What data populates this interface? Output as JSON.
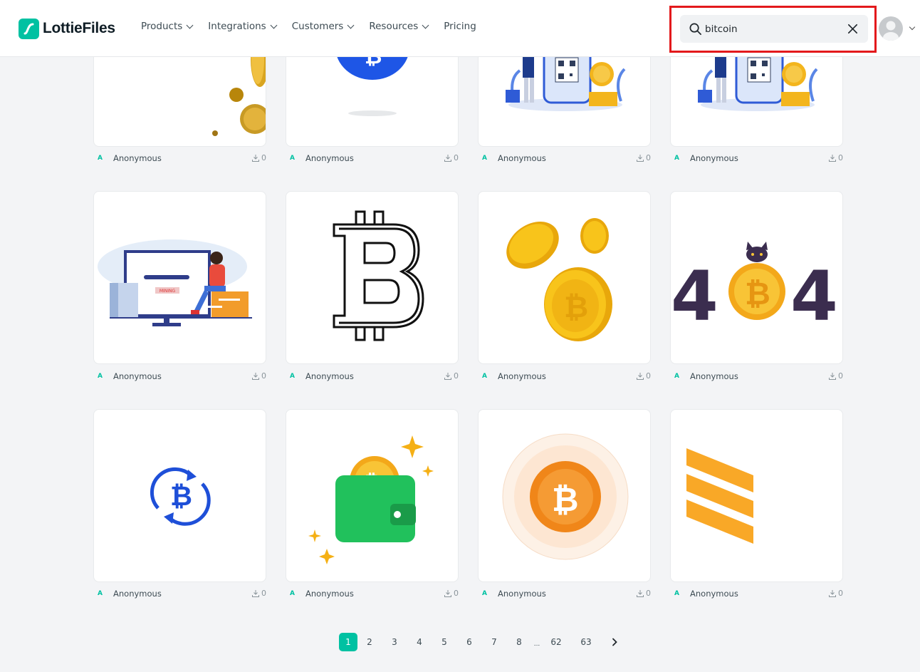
{
  "brand": {
    "name": "LottieFiles",
    "accent": "#00c1a2"
  },
  "nav": [
    {
      "label": "Products",
      "has_dropdown": true
    },
    {
      "label": "Integrations",
      "has_dropdown": true
    },
    {
      "label": "Customers",
      "has_dropdown": true
    },
    {
      "label": "Resources",
      "has_dropdown": true
    },
    {
      "label": "Pricing",
      "has_dropdown": false
    }
  ],
  "search": {
    "value": "bitcoin",
    "icon": "search-icon",
    "clear_icon": "close-icon",
    "highlight_color": "#e3191c"
  },
  "cards": [
    {
      "illustration": "bitcoin-coins-falling",
      "author": "Anonymous",
      "downloads": "0"
    },
    {
      "illustration": "bitcoin-blue-coin",
      "author": "Anonymous",
      "downloads": "0"
    },
    {
      "illustration": "person-phone-qr-coins",
      "author": "Anonymous",
      "downloads": "0"
    },
    {
      "illustration": "person-phone-qr-coins",
      "author": "Anonymous",
      "downloads": "0"
    },
    {
      "illustration": "bitcoin-mining-person",
      "author": "Anonymous",
      "downloads": "0",
      "inner_text": "MINING"
    },
    {
      "illustration": "bitcoin-outline-symbol",
      "author": "Anonymous",
      "downloads": "0"
    },
    {
      "illustration": "bitcoin-gold-coins",
      "author": "Anonymous",
      "downloads": "0"
    },
    {
      "illustration": "bitcoin-404-cat",
      "author": "Anonymous",
      "downloads": "0",
      "inner_text": "4"
    },
    {
      "illustration": "bitcoin-exchange-icon",
      "author": "Anonymous",
      "downloads": "0"
    },
    {
      "illustration": "bitcoin-green-wallet",
      "author": "Anonymous",
      "downloads": "0"
    },
    {
      "illustration": "bitcoin-orange-coin",
      "author": "Anonymous",
      "downloads": "0"
    },
    {
      "illustration": "orange-stripes-logo",
      "author": "Anonymous",
      "downloads": "0"
    }
  ],
  "pagination": {
    "current": "1",
    "pages": [
      "1",
      "2",
      "3",
      "4",
      "5",
      "6",
      "7",
      "8",
      "...",
      "62",
      "63"
    ],
    "next_icon": "chevron-right-icon"
  }
}
